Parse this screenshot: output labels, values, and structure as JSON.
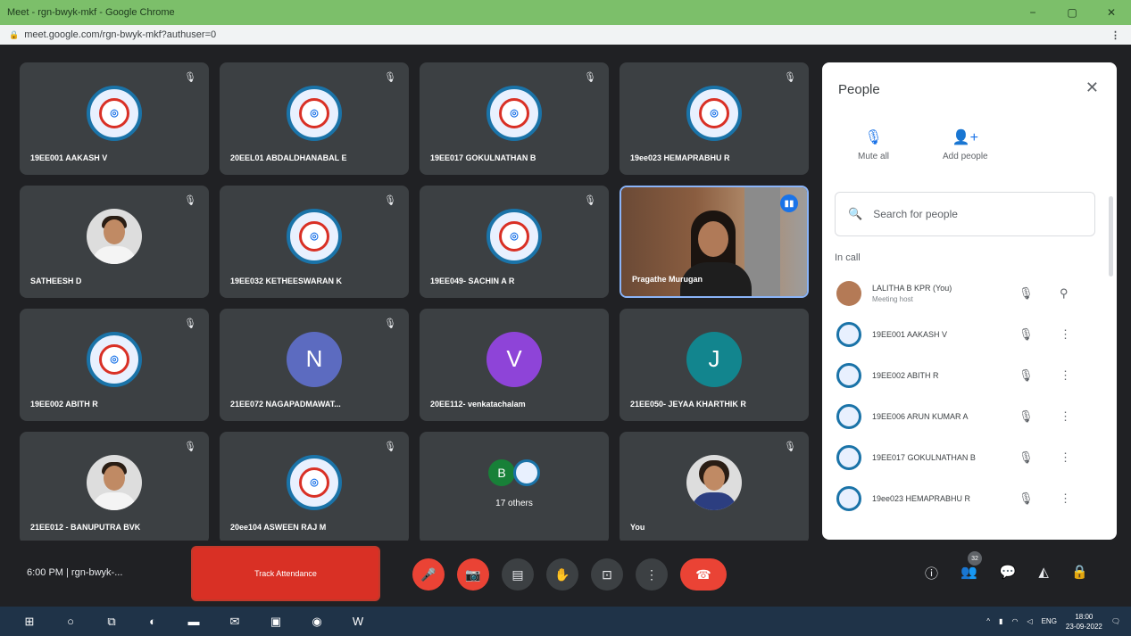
{
  "browser": {
    "title": "Meet - rgn-bwyk-mkf - Google Chrome",
    "url": "meet.google.com/rgn-bwyk-mkf?authuser=0",
    "menu_icon": "⋮",
    "min_label": "−",
    "max_label": "▢",
    "close_label": "✕"
  },
  "tiles": [
    {
      "name": "19EE001 AAKASH V",
      "type": "logo"
    },
    {
      "name": "20EEL01 ABDALDHANABAL E",
      "type": "logo"
    },
    {
      "name": "19EE017 GOKULNATHAN B",
      "type": "logo"
    },
    {
      "name": "19ee023 HEMAPRABHU R",
      "type": "logo"
    },
    {
      "name": "SATHEESH D",
      "type": "photo"
    },
    {
      "name": "19EE032 KETHEESWARAN K",
      "type": "logo"
    },
    {
      "name": "19EE049- SACHIN A R",
      "type": "logo"
    },
    {
      "name": "Pragathe Murugan",
      "type": "video"
    },
    {
      "name": "19EE002 ABITH R",
      "type": "logo"
    },
    {
      "name": "21EE072 NAGAPADMAWAT...",
      "type": "letter",
      "letter": "N",
      "color": "#5c6bc0"
    },
    {
      "name": "20EE112- venkatachalam",
      "type": "letter",
      "letter": "V",
      "color": "#8e44d8"
    },
    {
      "name": "21EE050- JEYAA KHARTHIK R",
      "type": "letter",
      "letter": "J",
      "color": "#12858e"
    },
    {
      "name": "21EE012 - BANUPUTRA BVK",
      "type": "photo"
    },
    {
      "name": "20ee104 ASWEEN RAJ M",
      "type": "logo"
    },
    {
      "name": "",
      "type": "others",
      "letter": "B",
      "label": "17 others"
    },
    {
      "name": "You",
      "type": "photo-female"
    }
  ],
  "panel": {
    "title": "People",
    "close": "✕",
    "mute_all": "Mute all",
    "add_people": "Add people",
    "search_placeholder": "Search for people",
    "in_call": "In call",
    "people": [
      {
        "name": "LALITHA B KPR (You)",
        "sub": "Meeting host",
        "self": true
      },
      {
        "name": "19EE001 AAKASH V",
        "sub": ""
      },
      {
        "name": "19EE002 ABITH R",
        "sub": ""
      },
      {
        "name": "19EE006 ARUN KUMAR A",
        "sub": ""
      },
      {
        "name": "19EE017 GOKULNATHAN B",
        "sub": ""
      },
      {
        "name": "19ee023 HEMAPRABHU R",
        "sub": ""
      }
    ]
  },
  "bottom": {
    "clock": "6:00 PM  |  rgn-bwyk-...",
    "attendance": "Track Attendance",
    "people_count": "32"
  },
  "taskbar": {
    "lang": "ENG",
    "time": "18:00",
    "date": "23-09-2022"
  }
}
